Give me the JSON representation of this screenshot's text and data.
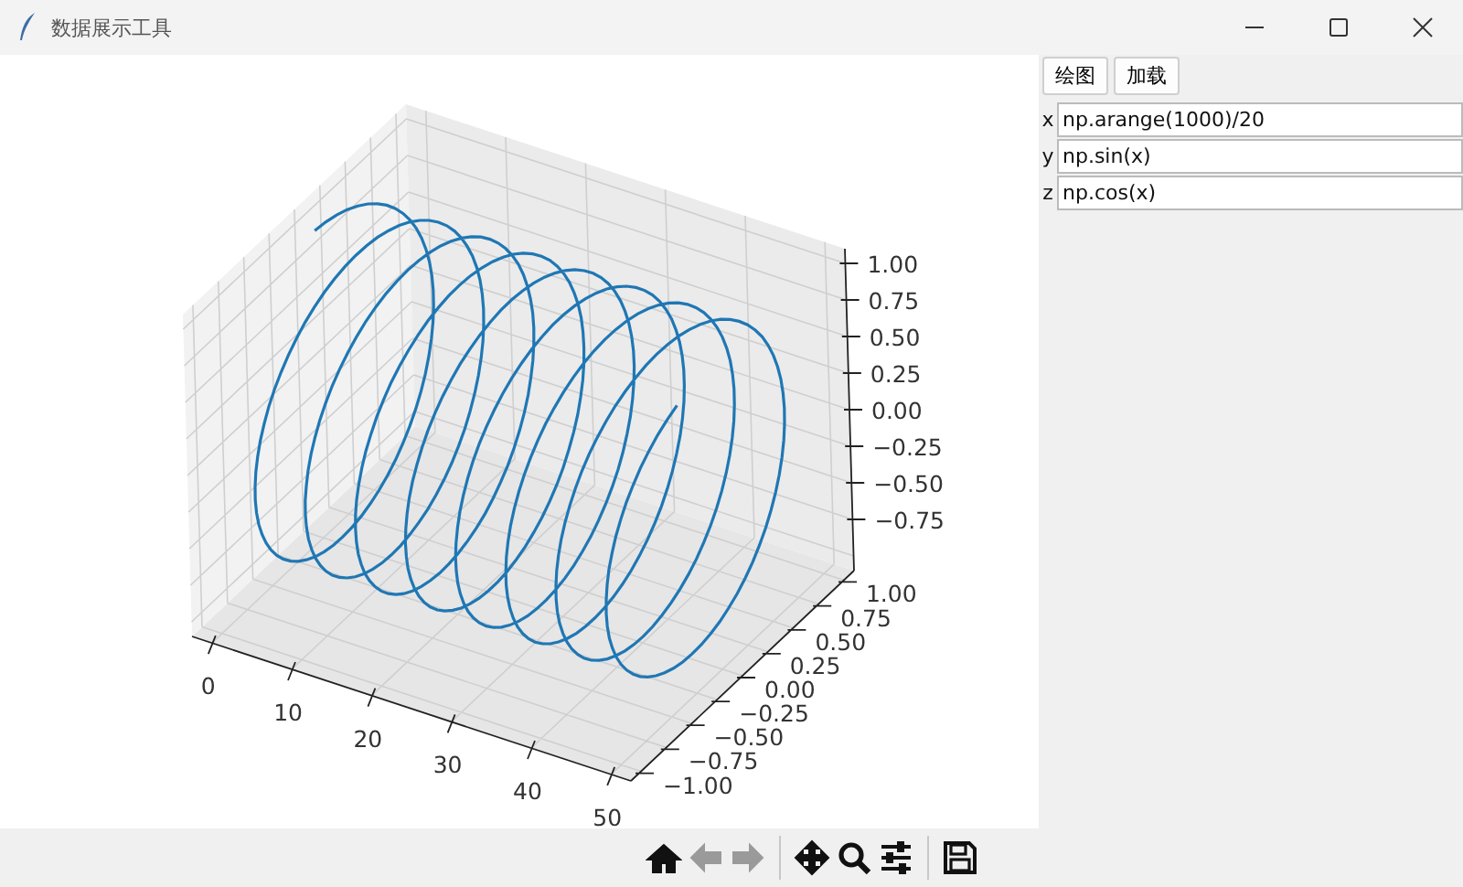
{
  "window": {
    "title": "数据展示工具"
  },
  "plot": {
    "x_ticks": [
      "0",
      "10",
      "20",
      "30",
      "40",
      "50"
    ],
    "y_ticks": [
      "1.00",
      "0.75",
      "0.50",
      "0.25",
      "0.00",
      "−0.25",
      "−0.50",
      "−0.75",
      "−1.00"
    ],
    "z_ticks": [
      "1.00",
      "0.75",
      "0.50",
      "0.25",
      "0.00",
      "−0.25",
      "−0.50",
      "−0.75"
    ]
  },
  "toolbar": [
    {
      "kind": "home",
      "disabled": false
    },
    {
      "kind": "back",
      "disabled": true
    },
    {
      "kind": "forward",
      "disabled": true
    },
    {
      "kind": "separator",
      "disabled": false
    },
    {
      "kind": "pan",
      "disabled": false
    },
    {
      "kind": "zoom",
      "disabled": false
    },
    {
      "kind": "configure",
      "disabled": false
    },
    {
      "kind": "separator",
      "disabled": false
    },
    {
      "kind": "save",
      "disabled": false
    }
  ],
  "buttons": [
    "绘图",
    "加载"
  ],
  "fields": [
    {
      "label": "x",
      "value": "np.arange(1000)/20"
    },
    {
      "label": "y",
      "value": "np.sin(x)"
    },
    {
      "label": "z",
      "value": "np.cos(x)"
    }
  ]
}
